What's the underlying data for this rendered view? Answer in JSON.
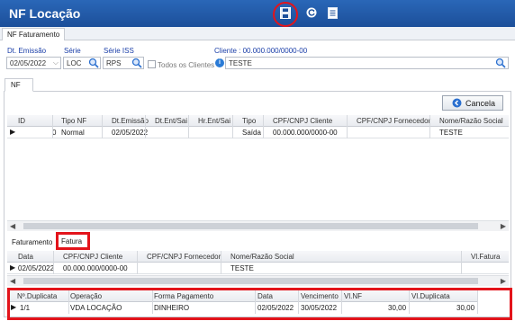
{
  "app": {
    "title": "NF Locação"
  },
  "toolbar": {
    "save_icon": "save-icon",
    "refresh_icon": "refresh-icon",
    "report_icon": "report-icon"
  },
  "top_tab": {
    "label": "NF Faturamento"
  },
  "filters": {
    "dt_emissao_label": "Dt. Emissão",
    "dt_emissao_value": "02/05/2022",
    "serie_label": "Série",
    "serie_value": "LOC",
    "serie_iss_label": "Série ISS",
    "serie_iss_value": "RPS",
    "todos_label": "Todos os Clientes",
    "cliente_label": "Cliente : 00.000.000/0000-00",
    "cliente_value": "TESTE"
  },
  "nf_tab": {
    "label": "NF"
  },
  "cancel_button": {
    "label": "Cancela"
  },
  "nf_grid": {
    "columns": [
      "ID",
      "Tipo NF",
      "Dt.Emissão",
      "Dt.Ent/Sai",
      "Hr.Ent/Sai",
      "Tipo",
      "CPF/CNPJ Cliente",
      "CPF/CNPJ Fornecedor",
      "Nome/Razão Social"
    ],
    "rows": [
      {
        "id": "0",
        "tipo_nf": "Normal",
        "dt_emissao": "02/05/2022",
        "dt_ent": "",
        "hr_ent": "",
        "tipo": "Saída",
        "cpf_cliente": "00.000.000/0000-00",
        "cpf_fornecedor": "",
        "nome": "TESTE"
      }
    ]
  },
  "sub_tabs": {
    "faturamento": "Faturamento",
    "fatura": "Fatura"
  },
  "fatura_grid": {
    "columns": [
      "Data",
      "CPF/CNPJ Cliente",
      "CPF/CNPJ  Fornecedor",
      "Nome/Razão Social",
      "Vl.Fatura"
    ],
    "rows": [
      {
        "data": "02/05/2022",
        "cpf_cliente": "00.000.000/0000-00",
        "cpf_fornecedor": "",
        "nome": "TESTE",
        "vl_fatura": ""
      }
    ]
  },
  "duplicata_grid": {
    "columns": [
      "Nº.Duplicata",
      "Operação",
      "Forma Pagamento",
      "Data",
      "Vencimento",
      "Vl.NF",
      "Vl.Duplicata"
    ],
    "rows": [
      {
        "numero": "1/1",
        "operacao": "VDA LOCAÇÃO",
        "forma": "DINHEIRO",
        "data": "02/05/2022",
        "vencimento": "30/05/2022",
        "vl_nf": "30,00",
        "vl_duplicata": "30,00"
      }
    ]
  },
  "colors": {
    "title_bar": "#1c4f9a",
    "label_blue": "#1a3ea8",
    "highlight_red": "#e3141b"
  }
}
